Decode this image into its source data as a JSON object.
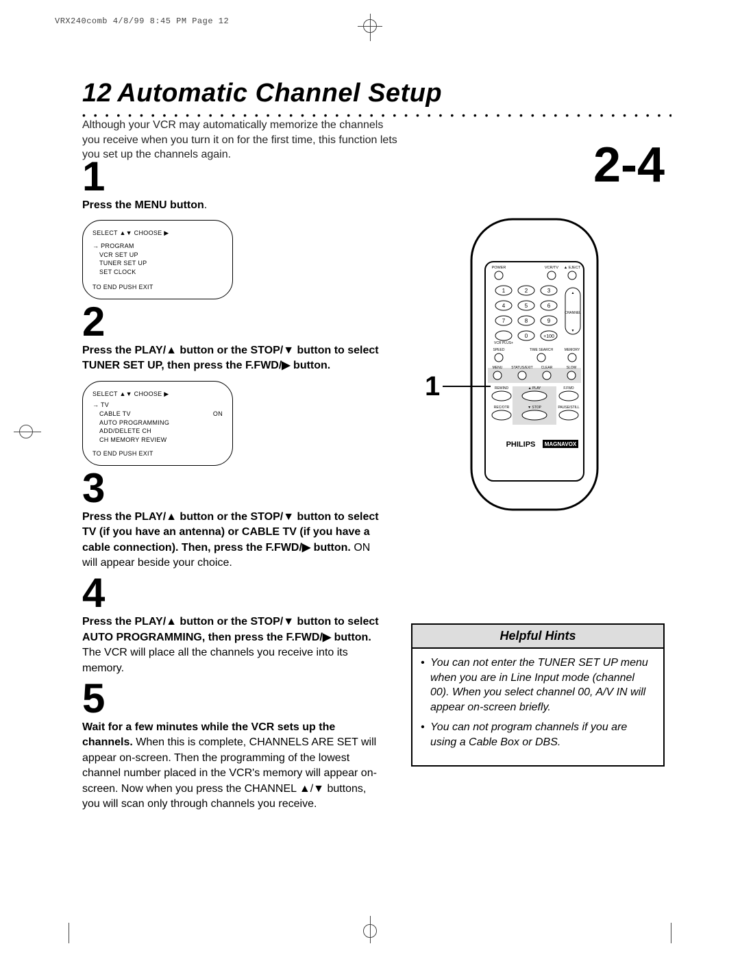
{
  "print": {
    "header": "VRX240comb  4/8/99 8:45 PM  Page 12"
  },
  "page": {
    "number": "12",
    "title": "Automatic Channel Setup"
  },
  "intro": "Although your VCR may automatically memorize the channels you receive when you turn it on for the first time, this function lets you set up the channels again.",
  "steps": {
    "s1": {
      "num": "1",
      "bold": "Press the MENU button",
      "tail": "."
    },
    "s2": {
      "num": "2",
      "bold": "Press the PLAY/▲ button or the STOP/▼ button to select TUNER SET UP, then press the F.FWD/▶ button."
    },
    "s3": {
      "num": "3",
      "bold": "Press the PLAY/▲ button or the STOP/▼ button to select TV (if you have an antenna) or CABLE TV (if you have a cable connection). Then, press the F.FWD/▶ button.",
      "tail": " ON will appear beside your choice."
    },
    "s4": {
      "num": "4",
      "bold": "Press the PLAY/▲ button or the STOP/▼ button to select AUTO PROGRAMMING, then press the F.FWD/▶ button.",
      "tail": " The VCR will place all the channels you receive into its memory."
    },
    "s5": {
      "num": "5",
      "bold": "Wait for a few minutes while the VCR sets up the channels.",
      "tail": " When this is complete, CHANNELS ARE SET will appear on-screen. Then the programming of the lowest channel number placed in the VCR's memory will appear on-screen. Now when you press the CHANNEL ▲/▼ buttons, you will scan only through channels you receive."
    }
  },
  "osd1": {
    "header": "SELECT ▲▼  CHOOSE ▶",
    "l1": "→ PROGRAM",
    "l2": "VCR SET UP",
    "l3": "TUNER SET UP",
    "l4": "SET CLOCK",
    "footer": "TO END PUSH EXIT"
  },
  "osd2": {
    "header": "SELECT ▲▼  CHOOSE ▶",
    "l1": "→ TV",
    "l2": "CABLE TV",
    "l2r": "ON",
    "l3": "AUTO PROGRAMMING",
    "l4": "ADD/DELETE CH",
    "l5": "CH MEMORY REVIEW",
    "footer": "TO END PUSH EXIT"
  },
  "right": {
    "range": "2-4",
    "callout": "1"
  },
  "remote": {
    "labels": {
      "power": "POWER",
      "vcrtv": "VCR/TV",
      "eject": "▲ EJECT",
      "b1": "1",
      "b2": "2",
      "b3": "3",
      "b4": "4",
      "b5": "5",
      "b6": "6",
      "b7": "7",
      "b8": "8",
      "b9": "9",
      "vcrplus": "VCR PLUS+",
      "b0": "0",
      "b100": "+100",
      "channel": "CHANNEL",
      "speed": "SPEED",
      "timesearch": "TIME SEARCH",
      "memory": "MEMORY",
      "menu": "MENU",
      "status": "STATUS/EXIT",
      "clear": "CLEAR",
      "slow": "SLOW",
      "rewind": "REWIND",
      "play": "▲ PLAY",
      "ffwd": "F.FWD",
      "recotr": "REC/OTR",
      "stop": "▼ STOP",
      "pause": "PAUSE/STILL",
      "brand1": "PHILIPS",
      "brand2": "MAGNAVOX"
    }
  },
  "hints": {
    "title": "Helpful Hints",
    "h1": "You can not enter the TUNER SET UP menu when you are in Line Input mode (channel 00). When you select channel 00, A/V IN will appear on-screen briefly.",
    "h2": "You can not program channels if you are using a Cable Box or DBS."
  }
}
